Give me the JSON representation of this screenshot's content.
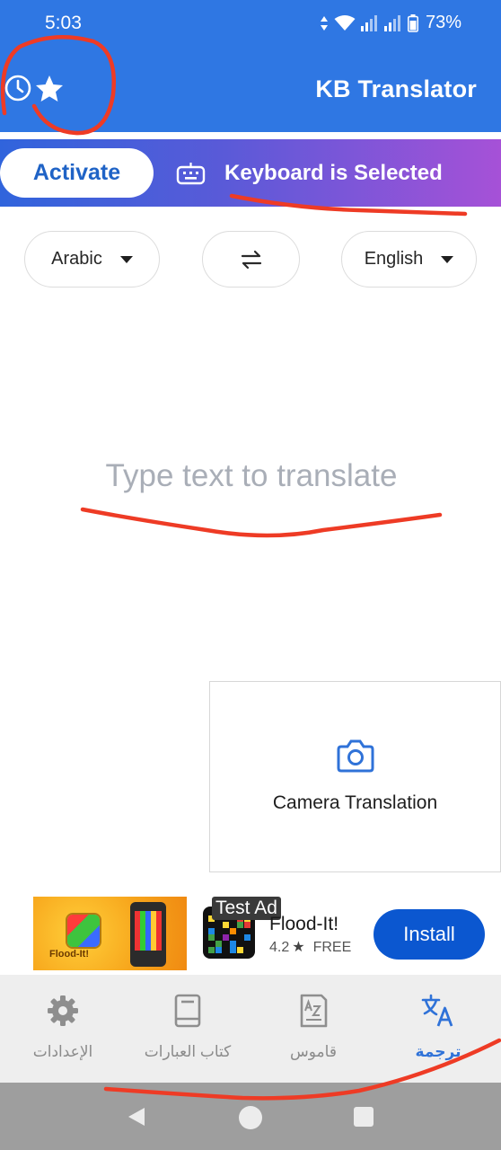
{
  "status_bar": {
    "time": "5:03",
    "battery": "73%"
  },
  "app_bar": {
    "title": "KB Translator",
    "left_icons": [
      "history-icon",
      "star-icon"
    ]
  },
  "banner": {
    "activate_label": "Activate",
    "status_text": "Keyboard is Selected",
    "icon": "keyboard-icon"
  },
  "languages": {
    "source": "Arabic",
    "target": "English",
    "swap_icon": "swap-arrows-icon"
  },
  "input": {
    "placeholder": "Type text to translate"
  },
  "camera": {
    "label": "Camera Translation",
    "icon": "camera-icon"
  },
  "ad": {
    "badge": "Test Ad",
    "app_name": "Flood-It!",
    "rating": "4.2",
    "price": "FREE",
    "install_label": "Install",
    "image_title": "Flood-It!"
  },
  "bottom_nav": [
    {
      "label": "الإعدادات",
      "icon": "gear-icon"
    },
    {
      "label": "كتاب العبارات",
      "icon": "book-icon"
    },
    {
      "label": "قاموس",
      "icon": "dictionary-icon"
    },
    {
      "label": "ترجمة",
      "icon": "translate-icon"
    }
  ],
  "colors": {
    "app_bar": "#2f77e3",
    "banner_start": "#3064dc",
    "banner_end": "#a651d7",
    "active_tab": "#2f72d8",
    "install_button": "#0b57d0",
    "annotation": "#ee3b25"
  }
}
